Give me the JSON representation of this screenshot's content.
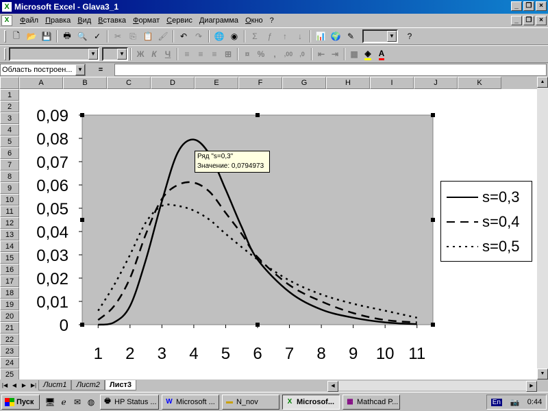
{
  "window": {
    "title": "Microsoft Excel - Glava3_1",
    "app_icon": "excel-icon"
  },
  "menu": {
    "items": [
      "Файл",
      "Правка",
      "Вид",
      "Вставка",
      "Формат",
      "Сервис",
      "Диаграмма",
      "Окно",
      "?"
    ]
  },
  "toolbar": {
    "standard_icons": [
      "new-icon",
      "open-icon",
      "save-icon",
      "print-icon",
      "print-preview-icon",
      "spelling-icon",
      "cut-icon",
      "copy-icon",
      "paste-icon",
      "format-painter-icon",
      "undo-icon",
      "redo-icon",
      "hyperlink-icon",
      "web-toolbar-icon",
      "autosum-icon",
      "function-icon",
      "sort-asc-icon",
      "sort-desc-icon",
      "chart-wizard-icon",
      "map-icon",
      "drawing-icon"
    ],
    "zoom_value": "",
    "help_icon": "help-icon"
  },
  "formatting": {
    "font_name": "",
    "font_size": "",
    "bold": "Ж",
    "italic": "К",
    "underline": "Ч",
    "percent": "%",
    "comma": ",",
    "inc_decimal": ",00",
    "dec_decimal": ",0"
  },
  "formula_bar": {
    "name_box": "Область построен...",
    "equals": "=",
    "value": ""
  },
  "columns": [
    "A",
    "B",
    "C",
    "D",
    "E",
    "F",
    "G",
    "H",
    "I",
    "J",
    "K"
  ],
  "rows": [
    "1",
    "2",
    "3",
    "4",
    "5",
    "6",
    "7",
    "8",
    "9",
    "10",
    "11",
    "12",
    "13",
    "14",
    "15",
    "16",
    "17",
    "18",
    "19",
    "20",
    "21",
    "22",
    "23",
    "24",
    "25"
  ],
  "tooltip": {
    "line1": "Ряд \"s=0,3\"",
    "line2": "Значение: 0,0794973"
  },
  "chart_data": {
    "type": "line",
    "title": "",
    "xlabel": "",
    "ylabel": "",
    "categories": [
      1,
      2,
      3,
      4,
      5,
      6,
      7,
      8,
      9,
      10,
      11
    ],
    "ylim": [
      0,
      0.09
    ],
    "yticks": [
      "0",
      "0,01",
      "0,02",
      "0,03",
      "0,04",
      "0,05",
      "0,06",
      "0,07",
      "0,08",
      "0,09"
    ],
    "legend_position": "right",
    "plot_background": "#c0c0c0",
    "series": [
      {
        "name": "s=0,3",
        "style": "solid",
        "points": [
          [
            1,
            0
          ],
          [
            1.5,
            0.001
          ],
          [
            2,
            0.008
          ],
          [
            2.5,
            0.028
          ],
          [
            3,
            0.053
          ],
          [
            3.5,
            0.074
          ],
          [
            4,
            0.0795
          ],
          [
            4.5,
            0.073
          ],
          [
            5,
            0.058
          ],
          [
            5.5,
            0.042
          ],
          [
            6,
            0.028
          ],
          [
            7,
            0.014
          ],
          [
            8,
            0.0065
          ],
          [
            9,
            0.003
          ],
          [
            10,
            0.001
          ],
          [
            11,
            0.0002
          ]
        ]
      },
      {
        "name": "s=0,4",
        "style": "dashed",
        "points": [
          [
            1,
            0.002
          ],
          [
            1.5,
            0.008
          ],
          [
            2,
            0.02
          ],
          [
            2.5,
            0.039
          ],
          [
            3,
            0.054
          ],
          [
            3.5,
            0.06
          ],
          [
            4,
            0.061
          ],
          [
            4.5,
            0.057
          ],
          [
            5,
            0.048
          ],
          [
            5.5,
            0.039
          ],
          [
            6,
            0.029
          ],
          [
            7,
            0.017
          ],
          [
            8,
            0.01
          ],
          [
            9,
            0.005
          ],
          [
            10,
            0.002
          ],
          [
            11,
            0.001
          ]
        ]
      },
      {
        "name": "s=0,5",
        "style": "dotted",
        "points": [
          [
            1,
            0.006
          ],
          [
            1.5,
            0.017
          ],
          [
            2,
            0.03
          ],
          [
            2.5,
            0.044
          ],
          [
            3,
            0.051
          ],
          [
            3.5,
            0.051
          ],
          [
            4,
            0.049
          ],
          [
            4.5,
            0.045
          ],
          [
            5,
            0.039
          ],
          [
            6,
            0.028
          ],
          [
            7,
            0.019
          ],
          [
            8,
            0.013
          ],
          [
            9,
            0.009
          ],
          [
            10,
            0.006
          ],
          [
            11,
            0.003
          ]
        ]
      }
    ]
  },
  "sheet_tabs": [
    "Лист1",
    "Лист2",
    "Лист3"
  ],
  "active_tab": "Лист3",
  "taskbar": {
    "start_label": "Пуск",
    "tasks": [
      {
        "label": "HP Status ...",
        "icon": "printer-icon"
      },
      {
        "label": "Microsoft ...",
        "icon": "word-icon"
      },
      {
        "label": "N_nov",
        "icon": "folder-icon"
      },
      {
        "label": "Microsof...",
        "icon": "excel-icon",
        "active": true
      },
      {
        "label": "Mathcad P...",
        "icon": "mathcad-icon"
      }
    ],
    "lang": "En",
    "clock": "0:44"
  }
}
